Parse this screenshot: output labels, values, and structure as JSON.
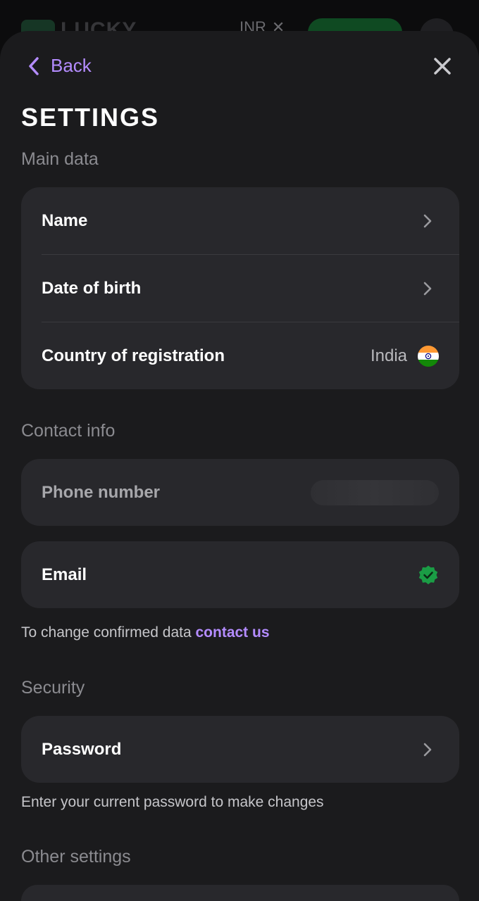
{
  "background": {
    "logo_text": "LUCKY",
    "currency": "INR"
  },
  "header": {
    "back_label": "Back"
  },
  "title": "SETTINGS",
  "sections": {
    "main_data": {
      "label": "Main data",
      "rows": {
        "name": "Name",
        "date_of_birth": "Date of birth",
        "country": "Country of registration",
        "country_value": "India"
      }
    },
    "contact_info": {
      "label": "Contact info",
      "phone": "Phone number",
      "email": "Email",
      "note": "To change confirmed data",
      "note_link": "contact us"
    },
    "security": {
      "label": "Security",
      "password": "Password",
      "note": "Enter your current password to make changes"
    },
    "other": {
      "label": "Other settings"
    }
  },
  "colors": {
    "accent": "#b48cff",
    "sheet_bg": "#1b1b1d",
    "card_bg": "#28282c",
    "verified_green": "#1a9c45"
  }
}
